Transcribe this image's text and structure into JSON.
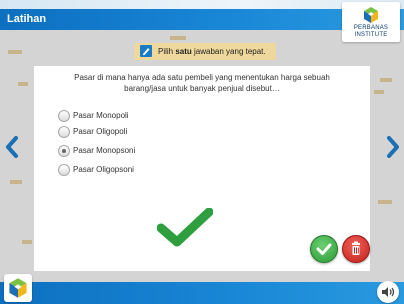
{
  "header": {
    "title": "Latihan"
  },
  "logo": {
    "line1": "PERBANAS",
    "line2": "INSTITUTE"
  },
  "instruction": {
    "prefix": "Pilih ",
    "bold": "satu",
    "suffix": " jawaban yang tepat."
  },
  "question": {
    "line1": "Pasar di mana hanya ada satu pembeli yang menentukan harga sebuah",
    "line2": "barang/jasa untuk banyak penjual disebut…"
  },
  "options": [
    {
      "label": "Pasar Monopoli",
      "selected": false
    },
    {
      "label": "Pasar Oligopoli",
      "selected": false
    },
    {
      "label": "Pasar Monopsoni",
      "selected": true
    },
    {
      "label": "Pasar Oligopsoni",
      "selected": false
    }
  ],
  "icons": {
    "prev": "chevron-left-icon",
    "next": "chevron-right-icon",
    "correct": "check-mark-icon",
    "submit": "check-circle-icon",
    "reset": "trash-icon",
    "audio": "speaker-icon"
  },
  "colors": {
    "header_blue": "#1986d6",
    "instruction_bar": "#efd89c",
    "correct_green": "#2e9e3f",
    "delete_red": "#c21f1a",
    "nav_blue": "#1a6fb5"
  }
}
